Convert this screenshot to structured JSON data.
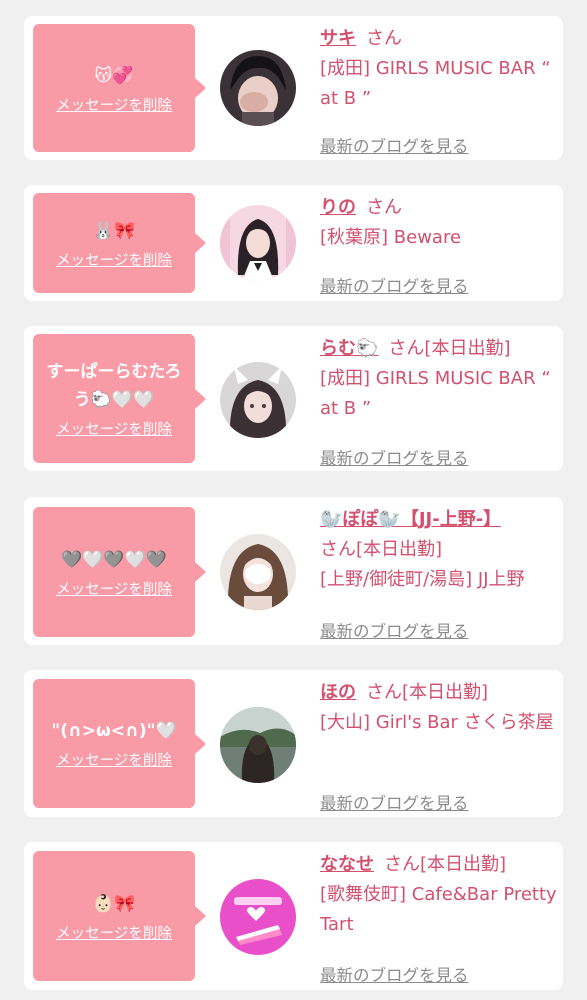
{
  "cards": [
    {
      "message": "😽💞",
      "delete_label": "メッセージを削除",
      "name": "サキ",
      "honorific": "さん",
      "status": "",
      "shop": "[成田] GIRLS MUSIC BAR “ at B ”",
      "blog_link": "最新のブログを見る"
    },
    {
      "message": "🐰🎀",
      "delete_label": "メッセージを削除",
      "name": "りの",
      "honorific": "さん",
      "status": "",
      "shop": "[秋葉原] Beware",
      "blog_link": "最新のブログを見る"
    },
    {
      "message": "すーぱーらむたろう🐑🤍🤍",
      "delete_label": "メッセージを削除",
      "name": "らむ🐑",
      "honorific": "さん",
      "status": "[本日出勤]",
      "shop": "[成田] GIRLS MUSIC BAR “ at B ”",
      "blog_link": "最新のブログを見る"
    },
    {
      "message": "🩶🤍🩶🤍🩶",
      "delete_label": "メッセージを削除",
      "name": "🦭ぽぽ🦭【JJ-上野-】",
      "honorific": "さん",
      "status": "[本日出勤]",
      "shop": "[上野/御徒町/湯島] JJ上野",
      "blog_link": "最新のブログを見る"
    },
    {
      "message": "\"(∩>ω<∩)\"🤍",
      "delete_label": "メッセージを削除",
      "name": "ほの",
      "honorific": "さん",
      "status": "[本日出勤]",
      "shop": "[大山] Girl's Bar さくら茶屋",
      "blog_link": "最新のブログを見る"
    },
    {
      "message": "👶🏻🎀",
      "delete_label": "メッセージを削除",
      "name": "ななせ",
      "honorific": "さん",
      "status": "[本日出勤]",
      "shop": "[歌舞伎町] Cafe&Bar Pretty Tart",
      "blog_link": "最新のブログを見る"
    }
  ],
  "colors": {
    "bubble": "#f99aa7",
    "name": "#d3506f",
    "link": "#8b8b8b",
    "background": "#f0f0f0"
  }
}
